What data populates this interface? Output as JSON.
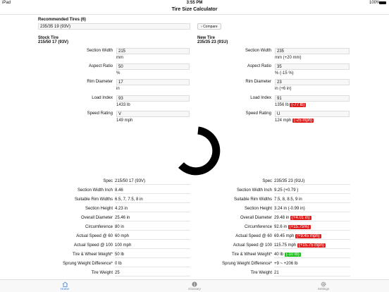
{
  "status_bar": {
    "left": "iPad",
    "time": "3:55 PM",
    "battery": "100%"
  },
  "nav_title": "Tire Size Calculator",
  "recommended": {
    "title": "Recommended Tires (6)",
    "selected": "235/35 19 (93V)",
    "compare_label": "Compare"
  },
  "stock": {
    "title": "Stock Tire",
    "size": "215/50 17 (93V)"
  },
  "new": {
    "title": "New Tire",
    "size": "235/35 23 (91U)"
  },
  "inputs": [
    {
      "label": "Section Width",
      "stock_value": "215",
      "stock_sub": "mm",
      "new_value": "235",
      "new_sub": "mm (+20 mm)",
      "new_badge": ""
    },
    {
      "label": "Aspect Ratio",
      "stock_value": "50",
      "stock_sub": "%",
      "new_value": "35",
      "new_sub": "% (-15 %)",
      "new_badge": ""
    },
    {
      "label": "Rim Diameter",
      "stock_value": "17",
      "stock_sub": "in",
      "new_value": "23",
      "new_sub": "in (+6 in)",
      "new_badge": ""
    },
    {
      "label": "Load Index",
      "stock_value": "93",
      "stock_sub": "1433 lb",
      "new_value": "91",
      "new_sub": "1356 lb",
      "new_badge": "(-77 lb)"
    },
    {
      "label": "Speed Rating",
      "stock_value": "V",
      "stock_sub": "149 mph",
      "new_value": "U",
      "new_sub": "124 mph",
      "new_badge": "(-25 mph)"
    }
  ],
  "specs": [
    {
      "label": "Spec",
      "stock": "215/50 17 (93V)",
      "new": "235/35 23 (91U)",
      "badge": "",
      "badge_color": ""
    },
    {
      "label": "Section Width Inch",
      "stock": "8.46",
      "new": "9.25 (+0.79 )",
      "badge": "",
      "badge_color": ""
    },
    {
      "label": "Suitable Rim Widths",
      "stock": "6.5, 7, 7.5, 8 in",
      "new": "7.5, 8, 8.5, 9 in",
      "badge": "",
      "badge_color": ""
    },
    {
      "label": "Section Height",
      "stock": "4.23 in",
      "new": "3.24 in (-0.99 in)",
      "badge": "",
      "badge_color": ""
    },
    {
      "label": "Overall Diameter",
      "stock": "25.46 in",
      "new": "29.48 in",
      "badge": "(+4.01 in)",
      "badge_color": "red"
    },
    {
      "label": "Circumference",
      "stock": "80 in",
      "new": "92.6 in",
      "badge": "(+15.75%)",
      "badge_color": "red"
    },
    {
      "label": "Actual Speed @ 60",
      "stock": "60 mph",
      "new": "69.45 mph",
      "badge": "(+9.45 mph)",
      "badge_color": "red"
    },
    {
      "label": "Actual Speed @ 100",
      "stock": "100 mph",
      "new": "115.75 mph",
      "badge": "(+15.75 mph)",
      "badge_color": "red"
    },
    {
      "label": "Tire & Wheel Weight*",
      "stock": "50 lb",
      "new": "40 lb",
      "badge": "(-10 lb)",
      "badge_color": "green"
    },
    {
      "label": "Sprung Weight Difference*",
      "stock": "0 lb",
      "new": "+9 ~ +206 lb",
      "badge": "",
      "badge_color": ""
    },
    {
      "label": "Tire Weight",
      "stock": "25",
      "new": "21",
      "badge": "",
      "badge_color": ""
    }
  ],
  "tabs": [
    {
      "label": "Home",
      "icon": "home-icon",
      "active": true
    },
    {
      "label": "Glossary",
      "icon": "info-icon",
      "active": false
    },
    {
      "label": "Settings",
      "icon": "gear-icon",
      "active": false
    }
  ],
  "colors": {
    "accent": "#3a7bd5",
    "red_badge": "#e01e1e",
    "green_badge": "#1fc01f"
  }
}
